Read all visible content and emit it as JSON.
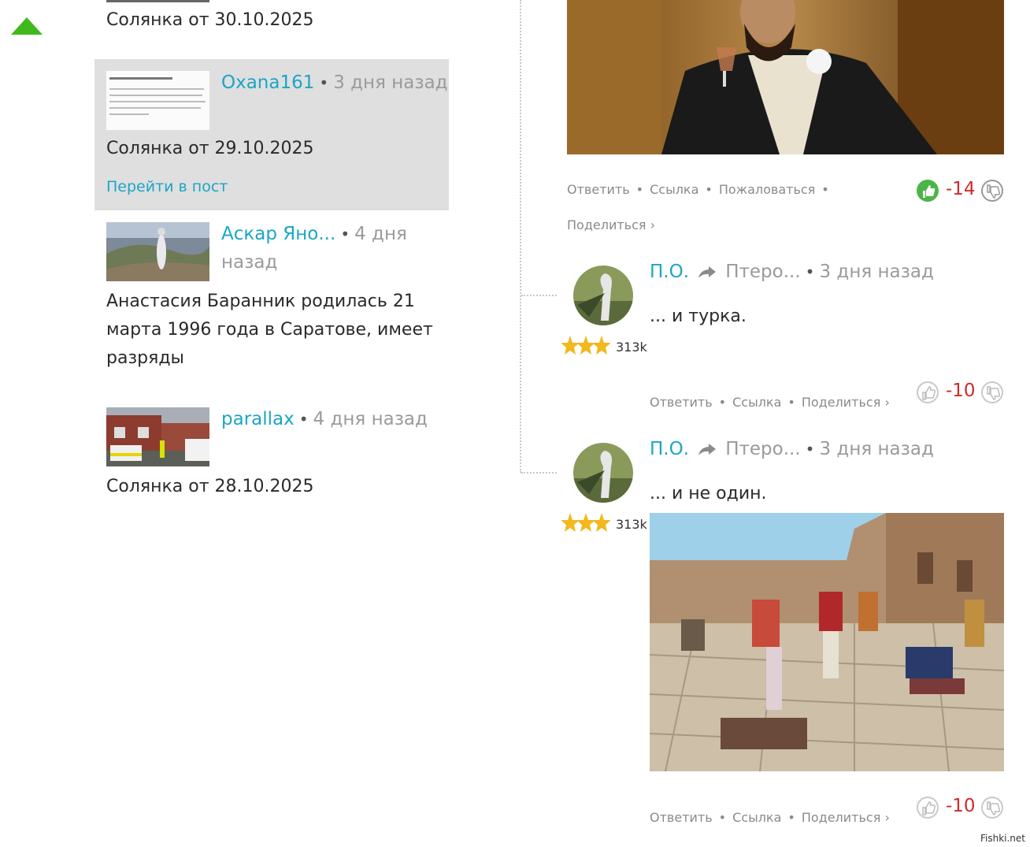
{
  "feed": {
    "items": [
      {
        "title": "Солянка от 30.10.2025"
      },
      {
        "author": "Oxana161",
        "time": "3 дня назад",
        "title": "Солянка от 29.10.2025",
        "link": "Перейти в пост"
      },
      {
        "author": "Аскар Яно...",
        "time_line1": "4 дня",
        "time_line2": "назад",
        "title_lines": [
          "Анастасия Баранник родилась 21",
          "марта 1996 года в Саратове, имеет",
          "разряды"
        ]
      },
      {
        "author": "parallax",
        "time": "4 дня назад",
        "title": "Солянка от 28.10.2025"
      }
    ]
  },
  "comments": [
    {
      "actions": [
        "Ответить",
        "Ссылка",
        "Пожаловаться"
      ],
      "share": "Поделиться ›",
      "score": "-14"
    },
    {
      "author": "П.О.",
      "reply_to": "Птеро...",
      "time": "3 дня назад",
      "text": "... и турка.",
      "karma": "313k",
      "actions": [
        "Ответить",
        "Ссылка",
        "Поделиться ›"
      ],
      "score": "-10"
    },
    {
      "author": "П.О.",
      "reply_to": "Птеро...",
      "time": "3 дня назад",
      "text": "... и не один.",
      "karma": "313k",
      "actions": [
        "Ответить",
        "Ссылка",
        "Поделиться ›"
      ],
      "score": "-10"
    }
  ],
  "watermark": "Fishki.net",
  "colors": {
    "accent": "#1ba6c4",
    "negative": "#d02a2a",
    "like_active": "#4bb548",
    "scroll_arrow": "#3fb91e"
  }
}
